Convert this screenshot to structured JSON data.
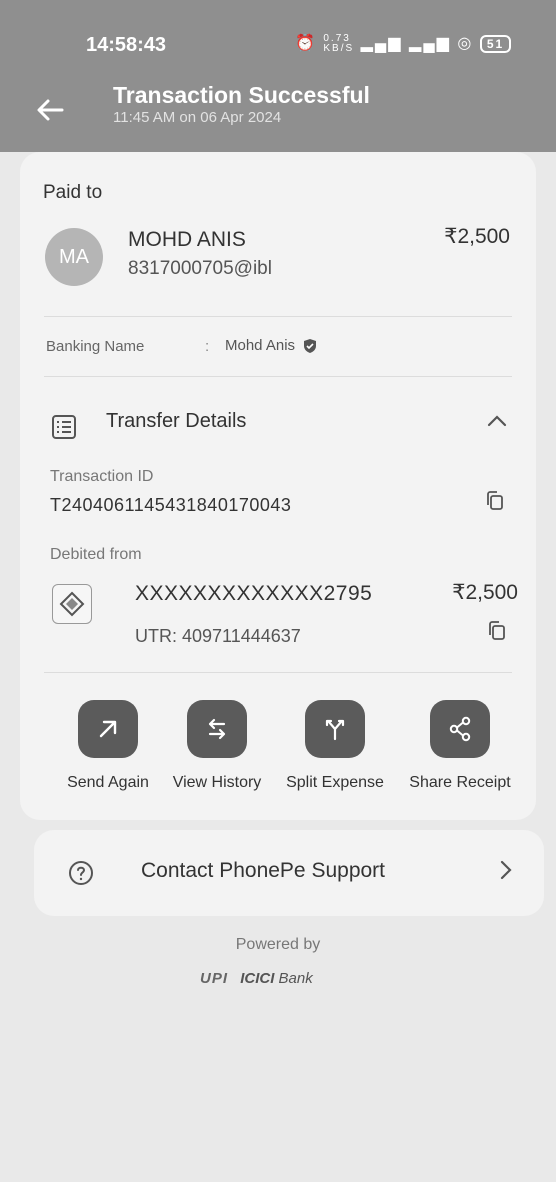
{
  "status_bar": {
    "time": "14:58:43",
    "data_rate": "0.73",
    "data_unit": "KB/S",
    "battery": "51"
  },
  "header": {
    "title": "Transaction Successful",
    "subtitle": "11:45 AM on 06 Apr 2024"
  },
  "paid_to": {
    "heading": "Paid to",
    "avatar_initials": "MA",
    "name": "MOHD ANIS",
    "upi_id": "8317000705@ibl",
    "amount": "₹2,500",
    "banking_name_label": "Banking Name",
    "banking_name_sep": ":",
    "banking_name_value": "Mohd Anis"
  },
  "transfer_details": {
    "title": "Transfer Details",
    "transaction_id_label": "Transaction ID",
    "transaction_id": "T2404061145431840170043",
    "debited_from_label": "Debited from",
    "account_number": "XXXXXXXXXXXXX2795",
    "debited_amount": "₹2,500",
    "utr": "UTR: 409711444637"
  },
  "actions": [
    {
      "label": "Send Again",
      "icon": "arrow-up-right-icon"
    },
    {
      "label": "View History",
      "icon": "swap-arrows-icon"
    },
    {
      "label": "Split Expense",
      "icon": "split-icon"
    },
    {
      "label": "Share Receipt",
      "icon": "share-icon"
    }
  ],
  "support": {
    "label": "Contact PhonePe Support"
  },
  "footer": {
    "powered_by": "Powered by",
    "upi_logo": "UPI",
    "icici_logo": "ICICI",
    "icici_bank": "Bank"
  },
  "colors": {
    "header_bg": "#8f8f8f",
    "page_bg": "#e9e9e9",
    "card_bg": "#f3f3f3",
    "action_btn": "#5b5b5b"
  }
}
